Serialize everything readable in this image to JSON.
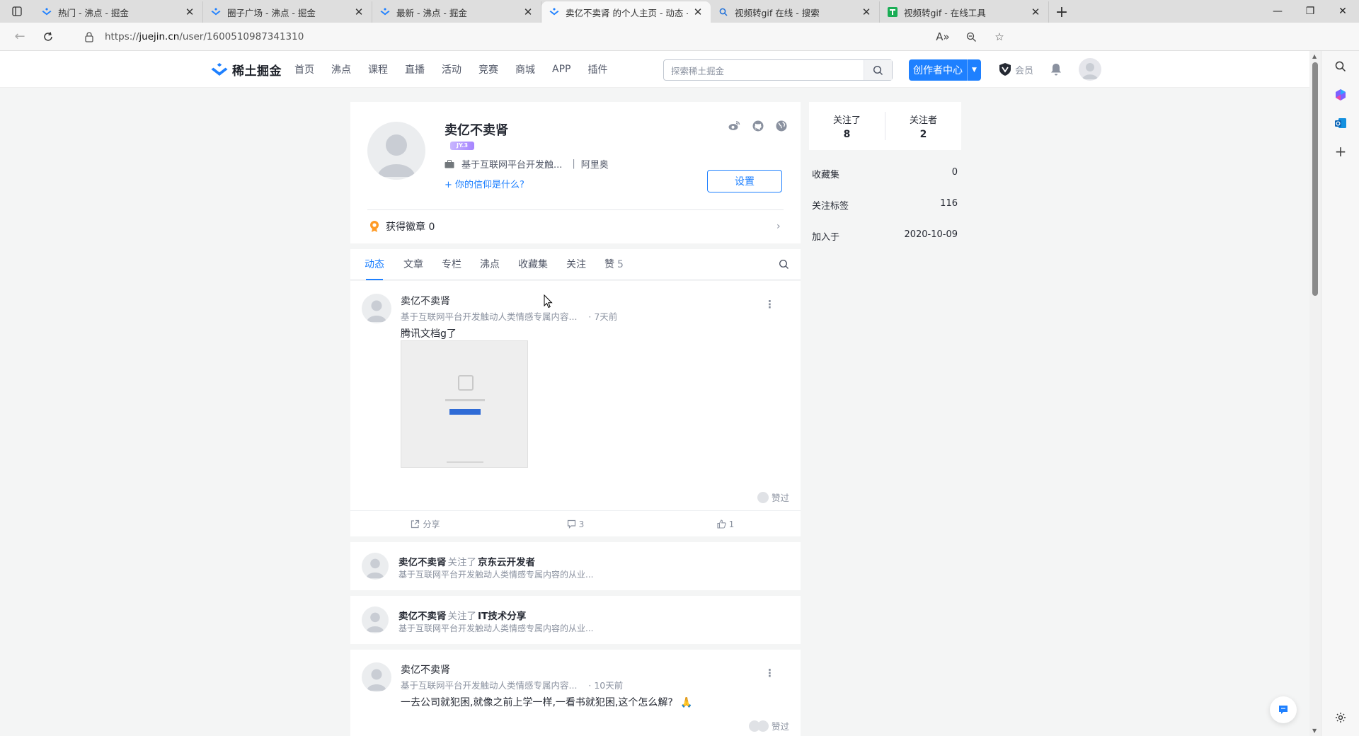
{
  "browser": {
    "tabs": [
      {
        "label": "热门 - 沸点 - 掘金",
        "icon": "juejin-icon"
      },
      {
        "label": "圈子广场 - 沸点 - 掘金",
        "icon": "juejin-icon"
      },
      {
        "label": "最新 - 沸点 - 掘金",
        "icon": "juejin-icon"
      },
      {
        "label": "卖亿不卖肾 的个人主页 - 动态 - 掘金",
        "icon": "juejin-icon",
        "active": true
      },
      {
        "label": "视频转gif 在线 - 搜索",
        "icon": "search-icon"
      },
      {
        "label": "视频转gif - 在线工具",
        "icon": "green-t-icon"
      }
    ],
    "url_prefix": "https://",
    "url_host": "juejin.cn",
    "url_path": "/user/1600510987341310"
  },
  "header": {
    "logo_text": "稀土掘金",
    "nav": [
      "首页",
      "沸点",
      "课程",
      "直播",
      "活动",
      "竞赛",
      "商城",
      "APP",
      "插件"
    ],
    "search_placeholder": "探索稀土掘金",
    "create_label": "创作者中心",
    "vip_label": "会员"
  },
  "profile": {
    "name": "卖亿不卖肾",
    "level": "JY.3",
    "job_brief": "基于互联网平台开发触...",
    "company": "阿里奥",
    "faith_prompt": "+ 你的信仰是什么?",
    "settings_label": "设置",
    "medals_label": "获得徽章 0"
  },
  "tabs": [
    {
      "label": "动态",
      "active": true
    },
    {
      "label": "文章"
    },
    {
      "label": "专栏"
    },
    {
      "label": "沸点"
    },
    {
      "label": "收藏集"
    },
    {
      "label": "关注"
    },
    {
      "label": "赞",
      "count": "5"
    }
  ],
  "feed": {
    "post1": {
      "author": "卖亿不卖肾",
      "brief": "基于互联网平台开发触动人类情感专属内容...",
      "time": "· 7天前",
      "text": "腾讯文档g了",
      "liked_by": "赞过",
      "share": "分享",
      "comments": "3",
      "likes": "1"
    },
    "follow1": {
      "author": "卖亿不卖肾",
      "verb": "关注了",
      "target": "京东云开发者",
      "brief": "基于互联网平台开发触动人类情感专属内容的从业..."
    },
    "follow2": {
      "author": "卖亿不卖肾",
      "verb": "关注了",
      "target": "IT技术分享",
      "brief": "基于互联网平台开发触动人类情感专属内容的从业..."
    },
    "post2": {
      "author": "卖亿不卖肾",
      "brief": "基于互联网平台开发触动人类情感专属内容...",
      "time": "· 10天前",
      "text": "一去公司就犯困,就像之前上学一样,一看书就犯困,这个怎么解?",
      "emoji": "🙏",
      "liked_by": "赞过"
    }
  },
  "side": {
    "following_label": "关注了",
    "following": "8",
    "followers_label": "关注者",
    "followers": "2",
    "stats": [
      {
        "label": "收藏集",
        "value": "0"
      },
      {
        "label": "关注标签",
        "value": "116"
      },
      {
        "label": "加入于",
        "value": "2020-10-09"
      }
    ]
  },
  "colors": {
    "brand": "#1e80ff",
    "page_bg": "#f4f5f5",
    "text": "#252933",
    "muted": "#8a919f"
  }
}
